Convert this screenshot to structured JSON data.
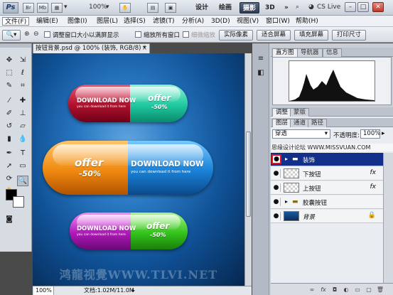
{
  "appbar": {
    "logo": "Ps",
    "icons": [
      "Br",
      "Mb"
    ],
    "zoom": "100%",
    "workspaces": [
      "设计",
      "绘画",
      "摄影",
      "3D"
    ],
    "active_workspace": "摄影",
    "overflow": "»",
    "cs_live": "CS Live",
    "window_buttons": [
      "–",
      "□",
      "✕"
    ]
  },
  "menubar": {
    "items": [
      "文件(F)",
      "编辑(E)",
      "图像(I)",
      "图层(L)",
      "选择(S)",
      "滤镜(T)",
      "分析(A)",
      "3D(D)",
      "视图(V)",
      "窗口(W)",
      "帮助(H)"
    ]
  },
  "options": {
    "resize_windows": "调整窗口大小以满屏显示",
    "zoom_all": "缩放所有窗口",
    "scrubby_zoom": "细微缩放",
    "actual_pixels": "实际像素",
    "fit_screen": "适合屏幕",
    "fill_screen": "填充屏幕",
    "print_size": "打印尺寸"
  },
  "document": {
    "tab_title": "按钮背景.psd @ 100% (装饰, RGB/8) *",
    "close": "×",
    "zoom": "100%",
    "doc_info": "文档:1.02M/11.0M",
    "watermark": "鸿龍视覺WWW.TLVI.NET"
  },
  "pills": [
    {
      "left": "DOWNLOAD NOW",
      "left_sub": "you can download it from here",
      "right": "offer",
      "right_sub": "-50%",
      "left_color": "#b0102c",
      "right_color": "#1fc8a0"
    },
    {
      "left": "offer",
      "left_sub": "-50%",
      "right": "DOWNLOAD NOW",
      "right_sub": "you can download it from here",
      "left_color": "#f08a10",
      "right_color": "#1a82d8"
    },
    {
      "left": "DOWNLOAD NOW",
      "left_sub": "you can download it from here",
      "right": "offer",
      "right_sub": "-50%",
      "left_color": "#b01ab8",
      "right_color": "#34c41c"
    }
  ],
  "panels": {
    "top_tabs": [
      "直方图",
      "导航器",
      "信息"
    ],
    "mid_tabs": [
      "调整",
      "蒙版"
    ],
    "layer_tabs": [
      "图层",
      "通道",
      "路径"
    ],
    "blend_mode": "穿透",
    "opacity_label": "不透明度:",
    "opacity_value": "100%",
    "overlay_text": "思缘设计论坛 WWW.MISSVUAN.COM",
    "layers": [
      {
        "name": "装饰",
        "type": "group",
        "selected": true
      },
      {
        "name": "下按钮",
        "type": "layer",
        "fx": "fx"
      },
      {
        "name": "上按钮",
        "type": "layer",
        "fx": "fx"
      },
      {
        "name": "胶囊按钮",
        "type": "group"
      },
      {
        "name": "背景",
        "type": "background",
        "locked": true
      }
    ],
    "footer_icons": [
      "link-icon",
      "fx-icon",
      "mask-icon",
      "adjust-icon",
      "folder-icon",
      "new-layer-icon",
      "trash-icon"
    ]
  },
  "colors": {
    "foreground": "#000000",
    "background": "#ffffff",
    "selection": "#12308a",
    "canvas_center": "#62a7e0",
    "canvas_edge": "#06274f"
  }
}
